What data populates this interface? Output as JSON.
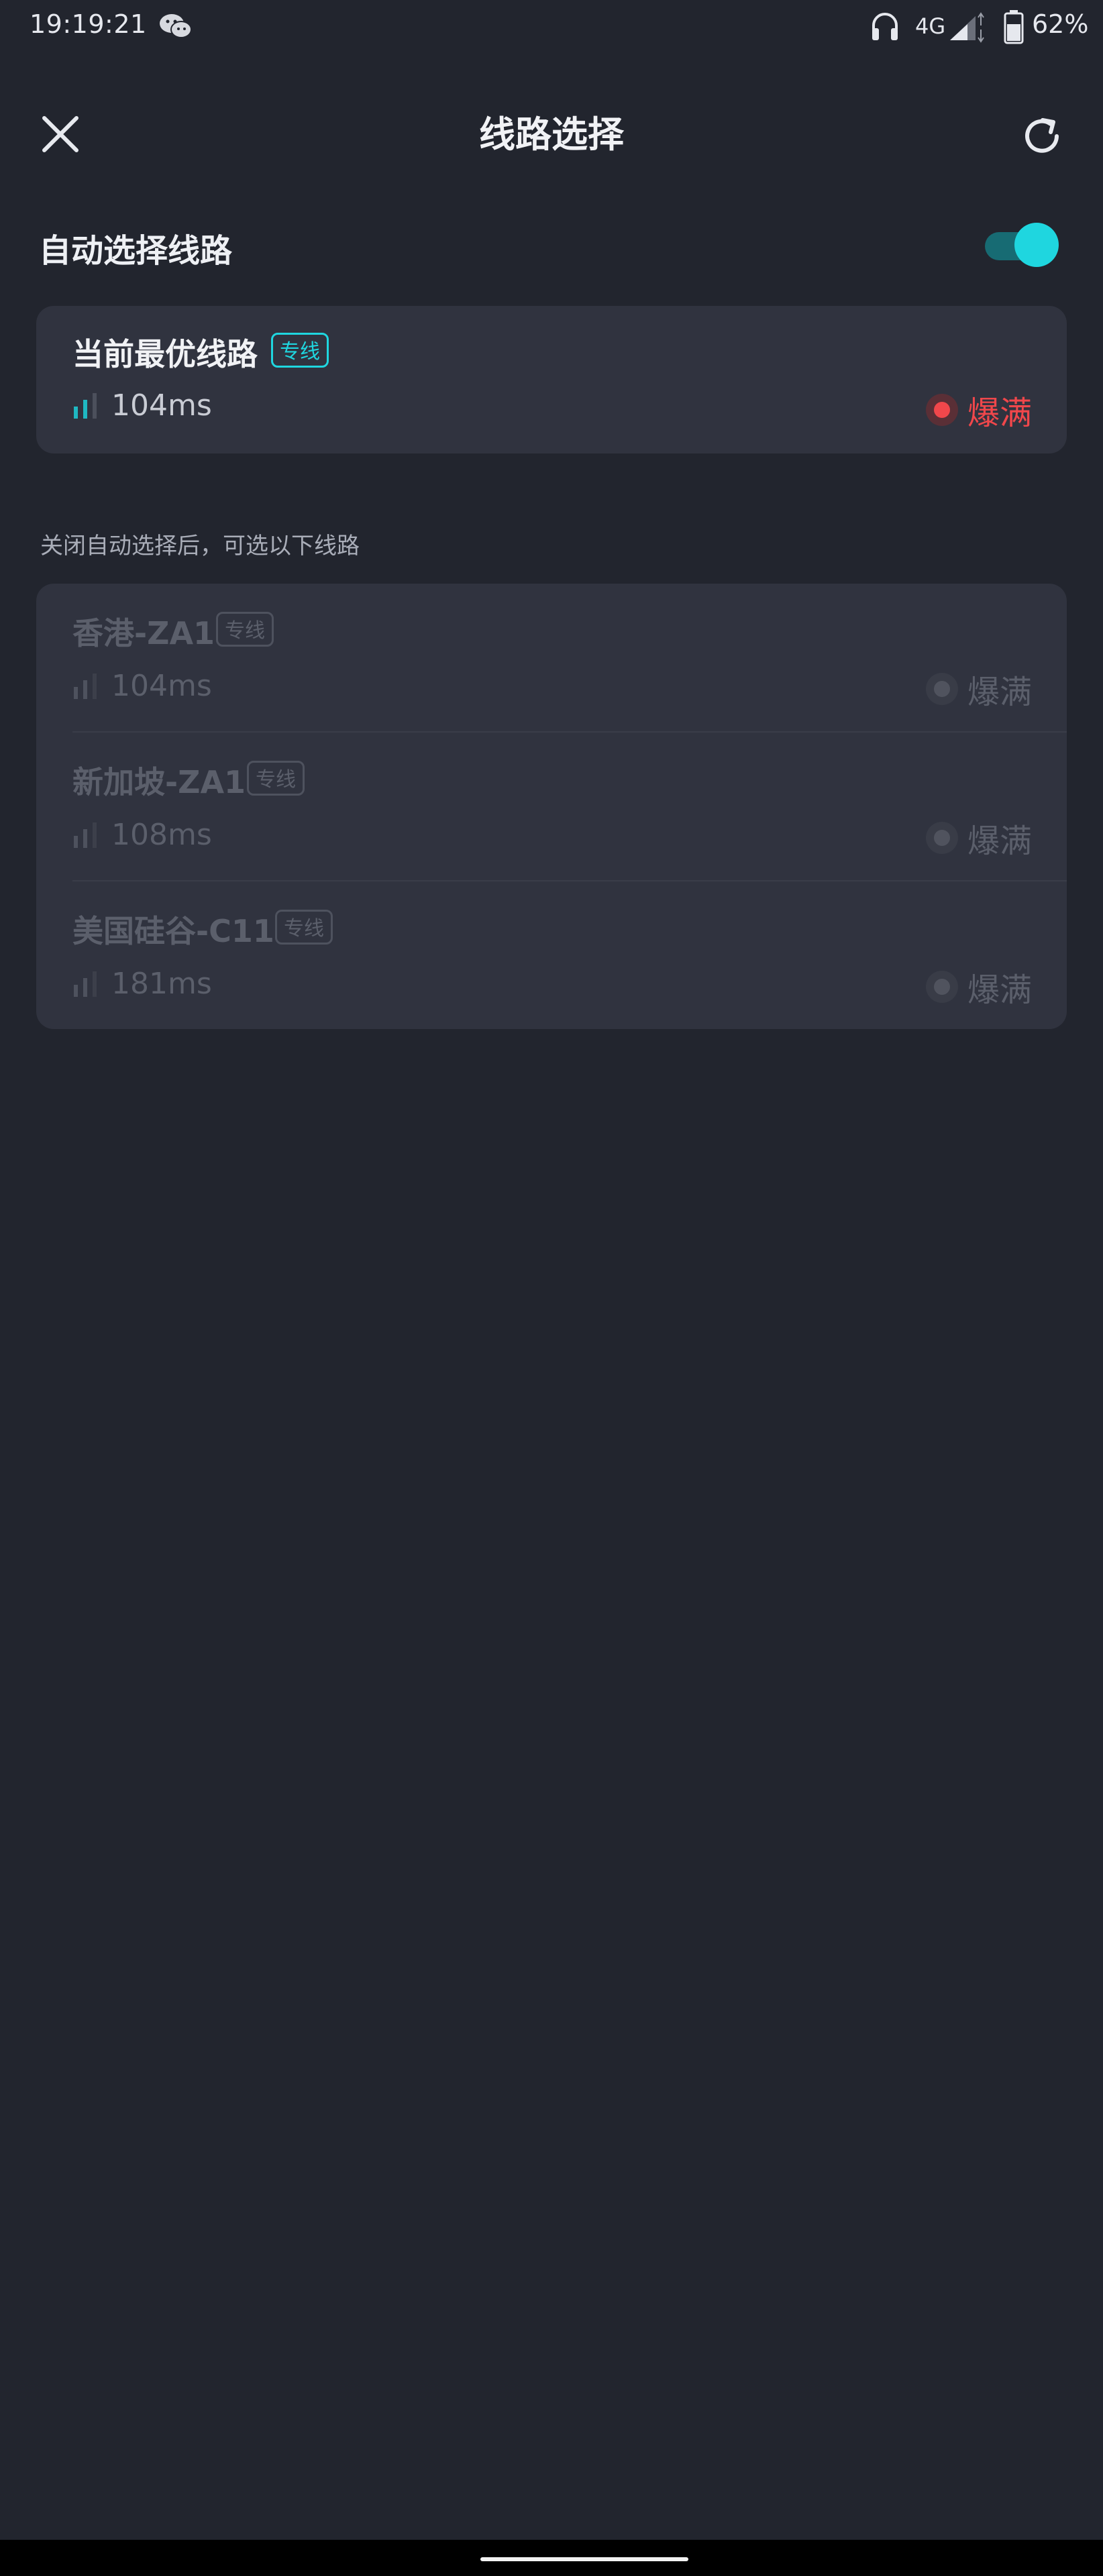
{
  "status_bar": {
    "time": "19:19:21",
    "network": "4G",
    "battery": "62%",
    "icons": [
      "wechat-icon",
      "headphone-icon",
      "signal-icon",
      "battery-icon"
    ]
  },
  "header": {
    "title": "线路选择",
    "close_icon": "close-icon",
    "refresh_icon": "refresh-icon"
  },
  "auto_select": {
    "label": "自动选择线路",
    "enabled": true
  },
  "best_line": {
    "title": "当前最优线路",
    "badge": "专线",
    "latency": "104ms",
    "status": "爆满",
    "status_color": "#f0474b",
    "accent": "#1fd6df"
  },
  "note": "关闭自动选择后，可选以下线路",
  "lines": [
    {
      "name": "香港-ZA1",
      "badge": "专线",
      "latency": "104ms",
      "status": "爆满"
    },
    {
      "name": "新加坡-ZA1",
      "badge": "专线",
      "latency": "108ms",
      "status": "爆满"
    },
    {
      "name": "美国硅谷-C11",
      "badge": "专线",
      "latency": "181ms",
      "status": "爆满"
    }
  ],
  "colors": {
    "background": "#22252e",
    "card": "#30333f",
    "disabled_text": "#5b5f6b"
  }
}
